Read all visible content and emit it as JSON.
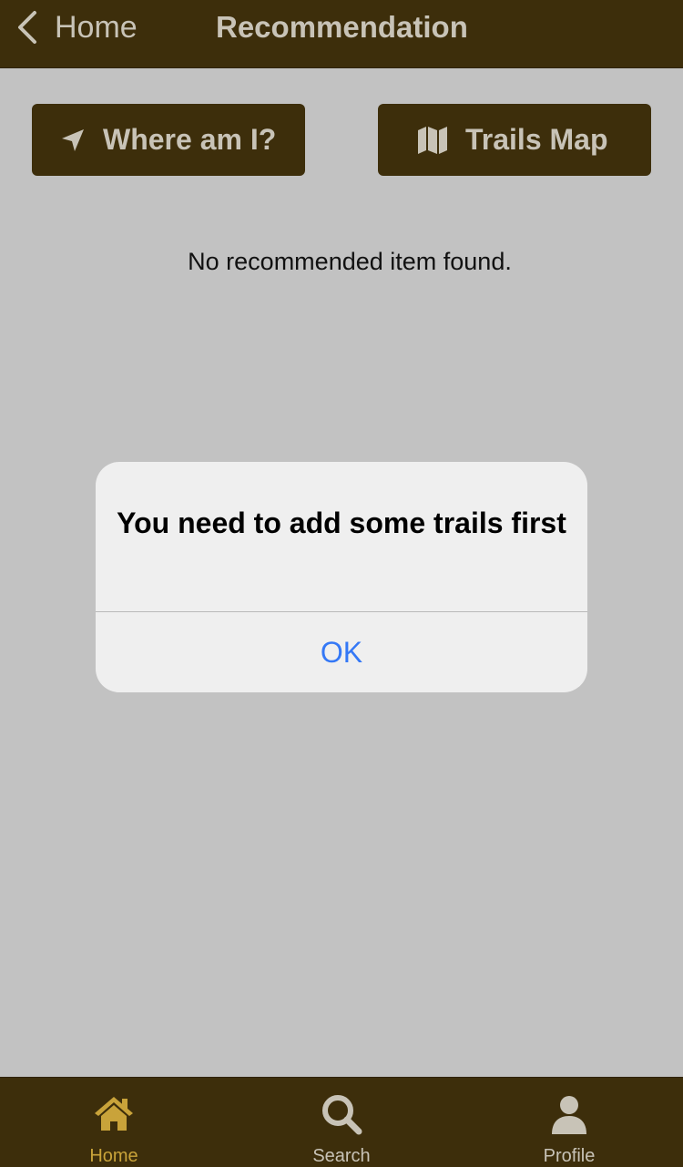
{
  "nav": {
    "back_label": "Home",
    "title": "Recommendation"
  },
  "actions": {
    "where_label": "Where am I?",
    "where_icon": "location-arrow-icon",
    "trails_label": "Trails Map",
    "trails_icon": "map-icon"
  },
  "content": {
    "empty_message": "No recommended item found."
  },
  "alert": {
    "title": "You need to add some trails first",
    "ok_label": "OK"
  },
  "tabs": [
    {
      "label": "Home",
      "icon": "home-icon",
      "active": true
    },
    {
      "label": "Search",
      "icon": "search-icon",
      "active": false
    },
    {
      "label": "Profile",
      "icon": "profile-icon",
      "active": false
    }
  ],
  "colors": {
    "bar": "#3d2e0b",
    "bar_text": "#c8c3b7",
    "active_tab": "#c9a33a",
    "background": "#c2c2c2",
    "alert_action": "#3478f6"
  }
}
